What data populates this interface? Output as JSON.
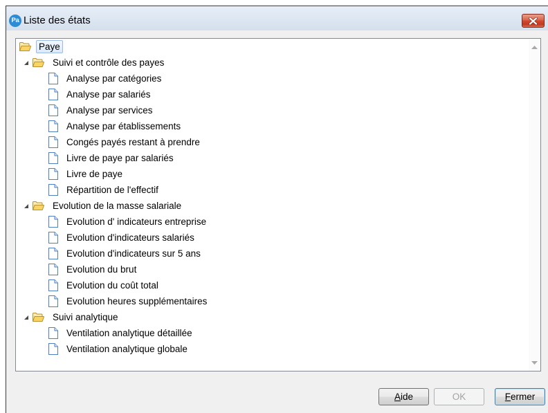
{
  "window": {
    "title": "Liste des états",
    "app_icon": {
      "icon": "app-logo-icon",
      "text": "Pa"
    },
    "close_icon": "close-icon"
  },
  "tree": {
    "folder_icon": "folder-open-icon",
    "item_icon": "document-icon",
    "expander_icon": "expanded-triangle-icon",
    "root": {
      "label": "Paye",
      "selected": true,
      "expanded": true
    },
    "groups": [
      {
        "label": "Suivi et contrôle des payes",
        "expanded": true,
        "items": [
          "Analyse par catégories",
          "Analyse par salariés",
          "Analyse par services",
          "Analyse par établissements",
          "Congés payés restant à prendre",
          "Livre de paye par salariés",
          "Livre de paye",
          "Répartition de l'effectif"
        ]
      },
      {
        "label": "Evolution de la masse salariale",
        "expanded": true,
        "items": [
          "Evolution d' indicateurs entreprise",
          "Evolution d'indicateurs salariés",
          "Evolution d'indicateurs sur 5 ans",
          "Evolution du brut",
          "Evolution du coût total",
          "Evolution heures supplémentaires"
        ]
      },
      {
        "label": "Suivi analytique",
        "expanded": true,
        "items": [
          "Ventilation analytique détaillée",
          "Ventilation analytique globale"
        ]
      }
    ]
  },
  "scrollbar": {
    "up_icon": "scroll-up-arrow-icon",
    "down_icon": "scroll-down-arrow-icon",
    "enabled": false
  },
  "buttons": {
    "help": {
      "label": "Aide",
      "accesskey_index": 0,
      "enabled": true
    },
    "ok": {
      "label": "OK",
      "enabled": false
    },
    "close": {
      "label": "Fermer",
      "accesskey_index": 0,
      "enabled": true,
      "default": true
    }
  },
  "colors": {
    "dialog_bg": "#f0f0f0",
    "selection_bg": "#dbe9f8",
    "selection_border": "#9dbbe0",
    "close_button": "#cf4a32",
    "app_icon": "#2d8cd4"
  }
}
